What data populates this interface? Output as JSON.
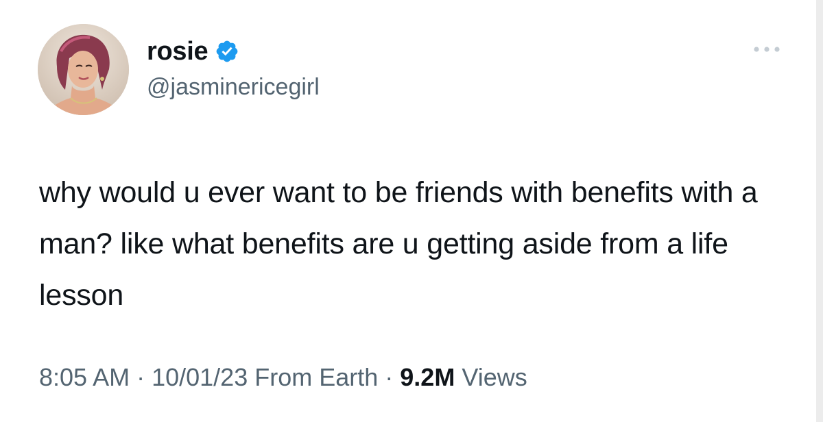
{
  "tweet": {
    "author": {
      "display_name": "rosie",
      "handle": "@jasminericegirl",
      "verified": true,
      "avatar_icon": "profile-photo"
    },
    "text": "why would u ever want to be friends with benefits with a man? like what benefits are u getting aside from a life lesson",
    "meta": {
      "time": "8:05 AM",
      "separator": "·",
      "date": "10/01/23",
      "source": "From Earth",
      "views_count": "9.2M",
      "views_label": "Views"
    },
    "more_icon": "ellipsis-icon"
  },
  "colors": {
    "text_primary": "#0f1419",
    "text_secondary": "#536471",
    "verified_badge": "#1d9bf0",
    "background": "#ffffff"
  }
}
